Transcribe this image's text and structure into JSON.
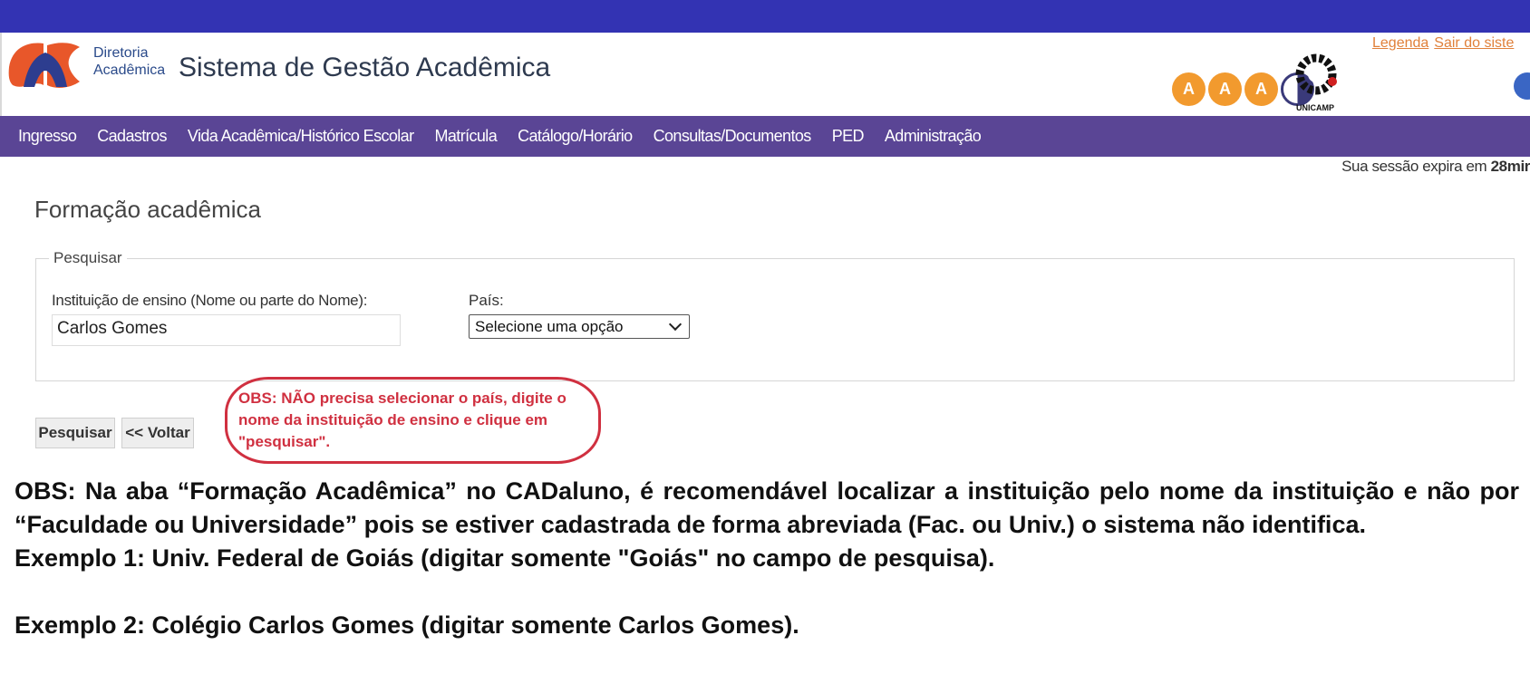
{
  "header": {
    "dir_line1": "Diretoria",
    "dir_line2": "Acadêmica",
    "app_title": "Sistema de Gestão Acadêmica",
    "links": [
      "Legenda",
      "Sair do siste"
    ],
    "accessibility_letters": [
      "A",
      "A",
      "A"
    ],
    "unicamp_label": "UNICAMP"
  },
  "nav": {
    "items": [
      "Ingresso",
      "Cadastros",
      "Vida Acadêmica/Histórico Escolar",
      "Matrícula",
      "Catálogo/Horário",
      "Consultas/Documentos",
      "PED",
      "Administração"
    ]
  },
  "session": {
    "prefix": "Sua sessão expira em ",
    "time": "28mir"
  },
  "page": {
    "title": "Formação acadêmica"
  },
  "search_form": {
    "legend": "Pesquisar",
    "institution_label": "Instituição de ensino (Nome ou parte do Nome):",
    "institution_value": "Carlos Gomes",
    "country_label": "País:",
    "country_selected": "Selecione uma opção",
    "search_button": "Pesquisar",
    "back_button": "<< Voltar"
  },
  "callout": {
    "text": "OBS: NÃO precisa selecionar o país, digite o nome da instituição de ensino e clique em \"pesquisar\"."
  },
  "notes": {
    "paragraph": "OBS: Na aba “Formação Acadêmica” no CADaluno, é recomendável localizar a instituição pelo nome da instituição e não por “Faculdade ou Universidade” pois se estiver cadastrada de forma abreviada (Fac. ou Univ.) o sistema não identifica.",
    "example1": "Exemplo 1: Univ. Federal de Goiás (digitar somente \"Goiás\" no campo de pesquisa).",
    "example2": "Exemplo 2: Colégio Carlos Gomes (digitar somente Carlos Gomes)."
  },
  "colors": {
    "topbar": "#3333b3",
    "navbar": "#5a4595",
    "link": "#e0803a",
    "callout": "#d03040"
  }
}
